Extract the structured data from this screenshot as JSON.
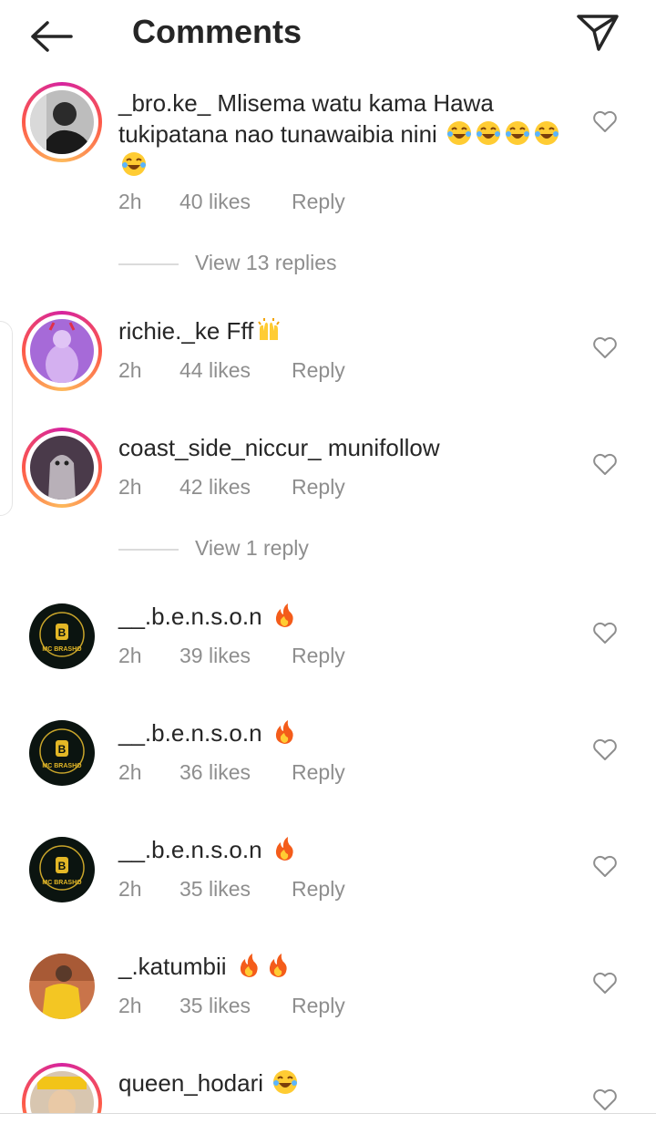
{
  "header": {
    "title": "Comments",
    "back_icon": "arrow-left-icon",
    "send_icon": "paper-plane-icon"
  },
  "colors": {
    "text": "#262626",
    "muted": "#8e8e8e",
    "divider": "#dbdbdb",
    "story_ring": "#d6249f"
  },
  "comments": [
    {
      "username": "_bro.ke_",
      "text": "Mlisema watu kama Hawa tukipatana nao tunawaibia nini",
      "emoji": "😂😂😂😂😂",
      "time": "2h",
      "likes": "40 likes",
      "reply": "Reply",
      "view_replies": "View 13 replies"
    },
    {
      "username": "richie._ke",
      "text": "Fff",
      "emoji": "🙌",
      "time": "2h",
      "likes": "44 likes",
      "reply": "Reply"
    },
    {
      "username": "coast_side_niccur_",
      "text": "munifollow",
      "emoji": "",
      "time": "2h",
      "likes": "42 likes",
      "reply": "Reply",
      "view_replies": "View 1 reply"
    },
    {
      "username": "__.b.e.n.s.o.n",
      "text": "",
      "emoji": "🔥",
      "time": "2h",
      "likes": "39 likes",
      "reply": "Reply"
    },
    {
      "username": "__.b.e.n.s.o.n",
      "text": "",
      "emoji": "🔥",
      "time": "2h",
      "likes": "36 likes",
      "reply": "Reply"
    },
    {
      "username": "__.b.e.n.s.o.n",
      "text": "",
      "emoji": "🔥",
      "time": "2h",
      "likes": "35 likes",
      "reply": "Reply"
    },
    {
      "username": "_.katumbii",
      "text": "",
      "emoji": "🔥🔥",
      "time": "2h",
      "likes": "35 likes",
      "reply": "Reply"
    },
    {
      "username": "queen_hodari",
      "text": "",
      "emoji": "😂",
      "time": "",
      "likes": "",
      "reply": ""
    }
  ],
  "logo_text": "MC BRASHO"
}
